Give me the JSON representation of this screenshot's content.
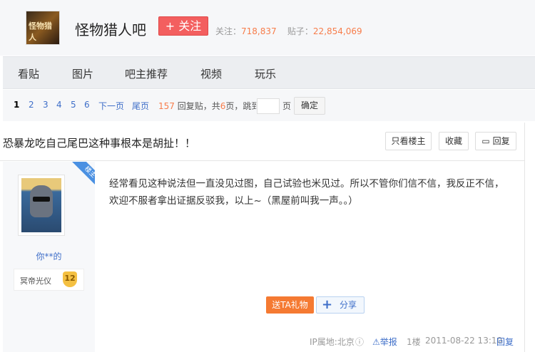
{
  "header": {
    "logo_text": "怪物猎人",
    "bar_name": "怪物猎人吧",
    "follow_label": "+ 关注",
    "followers_label": "关注：",
    "followers": "718,837",
    "posts_label": "贴子：",
    "posts": "22,854,069"
  },
  "nav": {
    "items": [
      "看贴",
      "图片",
      "吧主推荐",
      "视频",
      "玩乐"
    ]
  },
  "pager": {
    "pages": [
      "1",
      "2",
      "3",
      "4",
      "5",
      "6"
    ],
    "current": "1",
    "next": "下一页",
    "last": "尾页",
    "reply_count": "157",
    "reply_suffix": "回复贴，共",
    "total_pages": "6",
    "page_unit": "页，跳到",
    "jump_value": "",
    "page_label": "页",
    "confirm": "确定"
  },
  "thread": {
    "title": "恐暴龙吃自己尾巴这种事根本是胡扯！！",
    "only_op": "只看楼主",
    "favorite": "收藏",
    "reply": "回复"
  },
  "post": {
    "badge": "楼主",
    "username": "你**的",
    "rank_title": "冥帝光仪",
    "level": "12",
    "content": "经常看见这种说法但一直没见过图，自己试验也米见过。所以不管你们信不信，我反正不信，欢迎不服者拿出证据反驳我，以上~（黑屋前叫我一声。。）",
    "gift": "送TA礼物",
    "share": "分享",
    "ip": "IP属地:北京",
    "report": "举报",
    "floor": "1楼",
    "time": "2011-08-22 13:10",
    "reply": "回复"
  },
  "colors": {
    "accent": "#3f6fc9",
    "follow": "#f35f5f",
    "orange": "#f77d4b",
    "gift": "#f57a32"
  }
}
